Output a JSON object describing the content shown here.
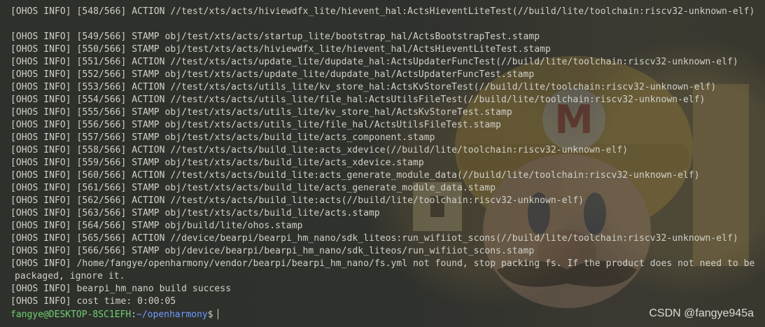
{
  "terminal": {
    "lines": [
      "[OHOS INFO] [548/566] ACTION //test/xts/acts/hiviewdfx_lite/hievent_hal:ActsHieventLiteTest(//build/lite/toolchain:riscv32-unknown-elf)",
      "",
      "[OHOS INFO] [549/566] STAMP obj/test/xts/acts/startup_lite/bootstrap_hal/ActsBootstrapTest.stamp",
      "[OHOS INFO] [550/566] STAMP obj/test/xts/acts/hiviewdfx_lite/hievent_hal/ActsHieventLiteTest.stamp",
      "[OHOS INFO] [551/566] ACTION //test/xts/acts/update_lite/dupdate_hal:ActsUpdaterFuncTest(//build/lite/toolchain:riscv32-unknown-elf)",
      "[OHOS INFO] [552/566] STAMP obj/test/xts/acts/update_lite/dupdate_hal/ActsUpdaterFuncTest.stamp",
      "[OHOS INFO] [553/566] ACTION //test/xts/acts/utils_lite/kv_store_hal:ActsKvStoreTest(//build/lite/toolchain:riscv32-unknown-elf)",
      "[OHOS INFO] [554/566] ACTION //test/xts/acts/utils_lite/file_hal:ActsUtilsFileTest(//build/lite/toolchain:riscv32-unknown-elf)",
      "[OHOS INFO] [555/566] STAMP obj/test/xts/acts/utils_lite/kv_store_hal/ActsKvStoreTest.stamp",
      "[OHOS INFO] [556/566] STAMP obj/test/xts/acts/utils_lite/file_hal/ActsUtilsFileTest.stamp",
      "[OHOS INFO] [557/566] STAMP obj/test/xts/acts/build_lite/acts_component.stamp",
      "[OHOS INFO] [558/566] ACTION //test/xts/acts/build_lite:acts_xdevice(//build/lite/toolchain:riscv32-unknown-elf)",
      "[OHOS INFO] [559/566] STAMP obj/test/xts/acts/build_lite/acts_xdevice.stamp",
      "[OHOS INFO] [560/566] ACTION //test/xts/acts/build_lite:acts_generate_module_data(//build/lite/toolchain:riscv32-unknown-elf)",
      "[OHOS INFO] [561/566] STAMP obj/test/xts/acts/build_lite/acts_generate_module_data.stamp",
      "[OHOS INFO] [562/566] ACTION //test/xts/acts/build_lite:acts(//build/lite/toolchain:riscv32-unknown-elf)",
      "[OHOS INFO] [563/566] STAMP obj/test/xts/acts/build_lite/acts.stamp",
      "[OHOS INFO] [564/566] STAMP obj/build/lite/ohos.stamp",
      "[OHOS INFO] [565/566] ACTION //device/bearpi/bearpi_hm_nano/sdk_liteos:run_wifiiot_scons(//build/lite/toolchain:riscv32-unknown-elf)",
      "[OHOS INFO] [566/566] STAMP obj/device/bearpi/bearpi_hm_nano/sdk_liteos/run_wifiiot_scons.stamp",
      "[OHOS INFO] /home/fangye/openharmony/vendor/bearpi/bearpi_hm_nano/fs.yml not found, stop packing fs. If the product does not need to be",
      "packaged, ignore it.",
      "[OHOS INFO] bearpi_hm_nano build success",
      "[OHOS INFO] cost time: 0:00:05"
    ],
    "prompt": {
      "user_host": "fangye@DESKTOP-8SC1EFH",
      "colon": ":",
      "path": "~/openharmony",
      "dollar": "$"
    }
  },
  "watermark": "CSDN @fangye945a",
  "colors": {
    "background": "#2e302c",
    "text": "#d0d0c8",
    "prompt_user": "#6fd26f",
    "prompt_path": "#6f9bff"
  }
}
